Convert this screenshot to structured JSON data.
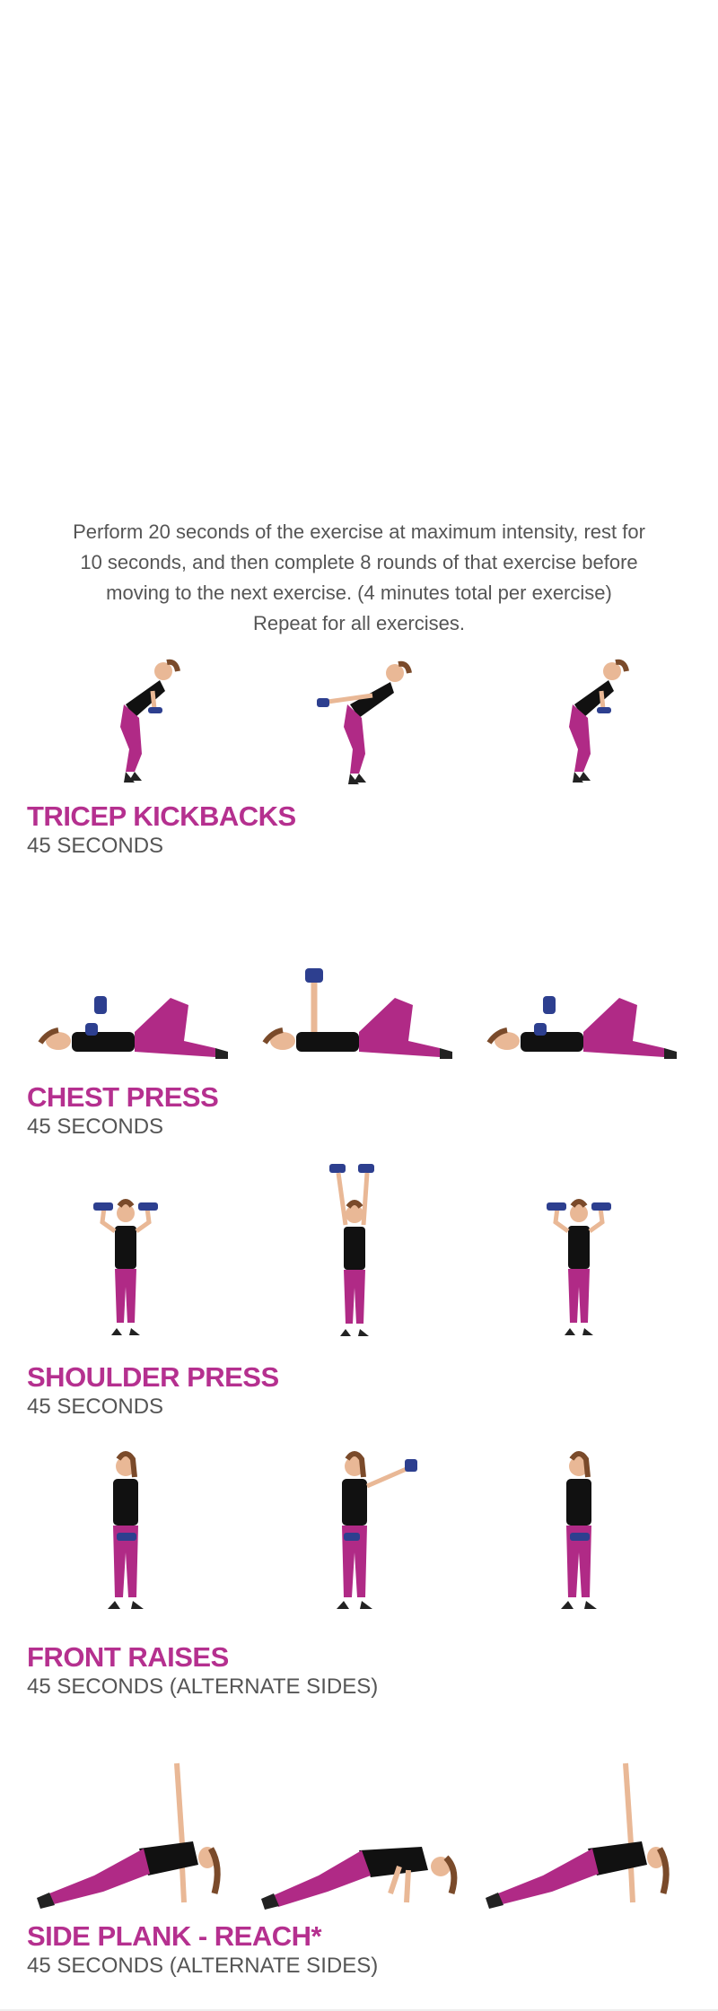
{
  "intro": {
    "line1": "Perform 20 seconds of the exercise at maximum intensity, rest for",
    "line2": "10 seconds, and then complete 8 rounds of that exercise before",
    "line3": "moving to the next exercise. (4 minutes total per exercise)",
    "line4": "Repeat for all exercises."
  },
  "colors": {
    "title": "#b5308f",
    "text": "#555555",
    "pants": "#b02a86",
    "top": "#111111",
    "skin": "#e9b896",
    "dumbbell": "#2d3f8f"
  },
  "exercises": [
    {
      "title": "TRICEP KICKBACKS",
      "duration": "45 SECONDS"
    },
    {
      "title": "CHEST PRESS",
      "duration": "45 SECONDS"
    },
    {
      "title": "SHOULDER PRESS",
      "duration": "45 SECONDS"
    },
    {
      "title": "FRONT RAISES",
      "duration": "45 SECONDS (ALTERNATE SIDES)"
    },
    {
      "title": "SIDE PLANK - REACH*",
      "duration": "45 SECONDS (ALTERNATE SIDES)"
    }
  ]
}
